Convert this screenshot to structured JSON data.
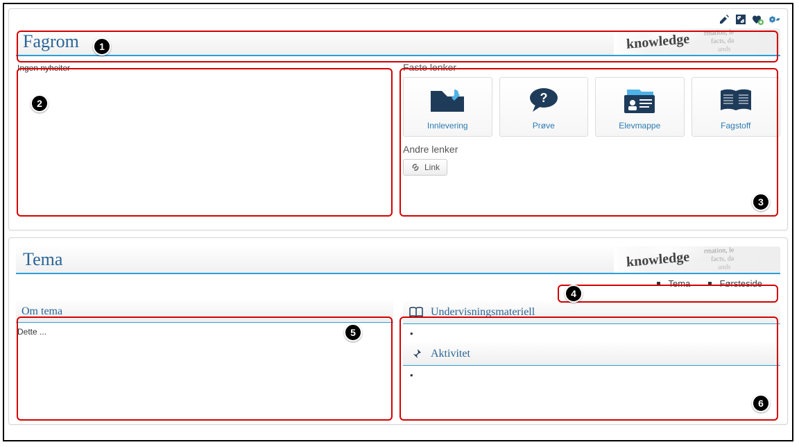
{
  "header": {
    "title": "Fagrom"
  },
  "news": {
    "empty_text": "Ingen nyheiter"
  },
  "links": {
    "faste_label": "Faste lenker",
    "andre_label": "Andre lenker",
    "tiles": [
      {
        "label": "Innlevering"
      },
      {
        "label": "Prøve"
      },
      {
        "label": "Elevmappe"
      },
      {
        "label": "Fagstoff"
      }
    ],
    "link_chip": "Link"
  },
  "tema": {
    "title": "Tema",
    "nav": [
      "Tema",
      "Førsteside"
    ],
    "om_header": "Om tema",
    "om_body": "Dette ...",
    "materiell_header": "Undervisningsmateriell",
    "materiell_bullet": "•",
    "aktivitet_header": "Aktivitet",
    "aktivitet_bullet": "•"
  },
  "callouts": [
    "1",
    "2",
    "3",
    "4",
    "5",
    "6"
  ],
  "bgword": {
    "big": "knowledge",
    "s1": "rmation, le",
    "s2": "facts, da",
    "s3": "ands"
  }
}
